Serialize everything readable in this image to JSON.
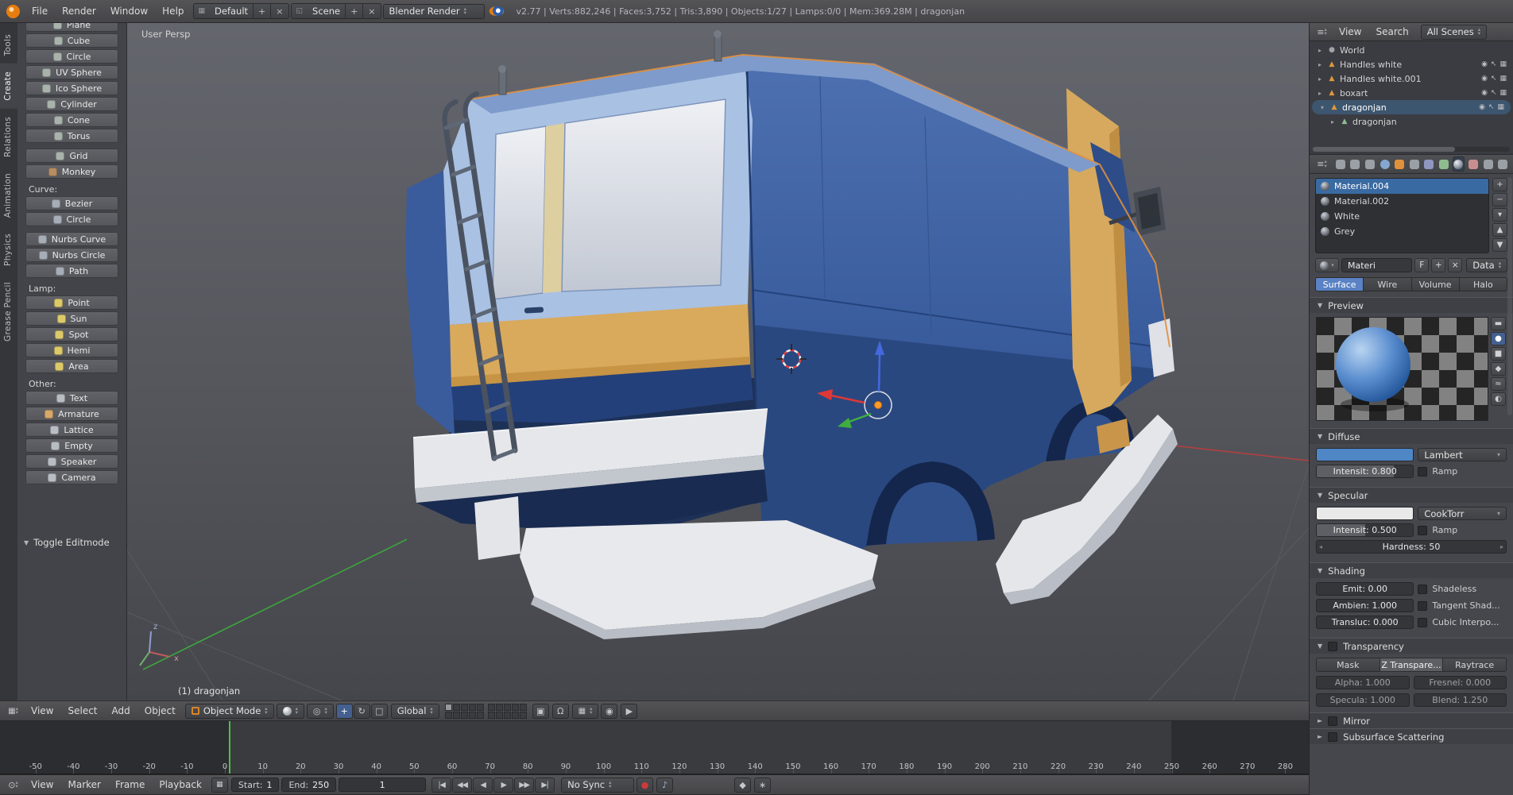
{
  "topbar": {
    "menus": [
      "File",
      "Render",
      "Window",
      "Help"
    ],
    "layout_selector": {
      "value": "Default",
      "add": "+",
      "close": "×"
    },
    "scene_selector": {
      "value": "Scene",
      "add": "+",
      "close": "×"
    },
    "engine_selector": {
      "value": "Blender Render"
    },
    "stats": "v2.77 | Verts:882,246 | Faces:3,752 | Tris:3,890 | Objects:1/27 | Lamps:0/0 | Mem:369.28M | dragonjan"
  },
  "toolshelf": {
    "tabs": [
      {
        "label": "Tools",
        "active": false
      },
      {
        "label": "Create",
        "active": true
      },
      {
        "label": "Relations",
        "active": false
      },
      {
        "label": "Animation",
        "active": false
      },
      {
        "label": "Physics",
        "active": false
      },
      {
        "label": "Grease Pencil",
        "active": false
      }
    ],
    "groups": [
      {
        "heading": "",
        "buttons": [
          {
            "label": "Plane",
            "icon": "mesh-plane-icon",
            "icon_color": "#a9b3ab"
          },
          {
            "label": "Cube",
            "icon": "mesh-cube-icon",
            "icon_color": "#a9b3ab"
          },
          {
            "label": "Circle",
            "icon": "mesh-circle-icon",
            "icon_color": "#a9b3ab"
          },
          {
            "label": "UV Sphere",
            "icon": "mesh-uvsphere-icon",
            "icon_color": "#a9b3ab"
          },
          {
            "label": "Ico Sphere",
            "icon": "mesh-icosphere-icon",
            "icon_color": "#a9b3ab"
          },
          {
            "label": "Cylinder",
            "icon": "mesh-cylinder-icon",
            "icon_color": "#a9b3ab"
          },
          {
            "label": "Cone",
            "icon": "mesh-cone-icon",
            "icon_color": "#a9b3ab"
          },
          {
            "label": "Torus",
            "icon": "mesh-torus-icon",
            "icon_color": "#a9b3ab"
          }
        ]
      },
      {
        "heading": "",
        "buttons": [
          {
            "label": "Grid",
            "icon": "mesh-grid-icon",
            "icon_color": "#a9b3ab"
          },
          {
            "label": "Monkey",
            "icon": "mesh-monkey-icon",
            "icon_color": "#b58d62"
          }
        ]
      },
      {
        "heading": "Curve:",
        "buttons": [
          {
            "label": "Bezier",
            "icon": "curve-bezier-icon",
            "icon_color": "#a6adb6"
          },
          {
            "label": "Circle",
            "icon": "curve-circle-icon",
            "icon_color": "#a6adb6"
          }
        ]
      },
      {
        "heading": "",
        "buttons": [
          {
            "label": "Nurbs Curve",
            "icon": "nurbs-curve-icon",
            "icon_color": "#a6adb6"
          },
          {
            "label": "Nurbs Circle",
            "icon": "nurbs-circle-icon",
            "icon_color": "#a6adb6"
          },
          {
            "label": "Path",
            "icon": "curve-path-icon",
            "icon_color": "#a6adb6"
          }
        ]
      },
      {
        "heading": "Lamp:",
        "buttons": [
          {
            "label": "Point",
            "icon": "lamp-point-icon",
            "icon_color": "#dcc96a"
          },
          {
            "label": "Sun",
            "icon": "lamp-sun-icon",
            "icon_color": "#dcc96a"
          },
          {
            "label": "Spot",
            "icon": "lamp-spot-icon",
            "icon_color": "#dcc96a"
          },
          {
            "label": "Hemi",
            "icon": "lamp-hemi-icon",
            "icon_color": "#dcc96a"
          },
          {
            "label": "Area",
            "icon": "lamp-area-icon",
            "icon_color": "#dcc96a"
          }
        ]
      },
      {
        "heading": "Other:",
        "buttons": [
          {
            "label": "Text",
            "icon": "text-icon",
            "icon_color": "#b8bdc4"
          },
          {
            "label": "Armature",
            "icon": "armature-icon",
            "icon_color": "#d8a869"
          },
          {
            "label": "Lattice",
            "icon": "lattice-icon",
            "icon_color": "#b8bdc4"
          },
          {
            "label": "Empty",
            "icon": "empty-icon",
            "icon_color": "#b8bdc4"
          },
          {
            "label": "Speaker",
            "icon": "speaker-icon",
            "icon_color": "#b8bdc4"
          },
          {
            "label": "Camera",
            "icon": "camera-icon",
            "icon_color": "#b8bdc4"
          }
        ]
      }
    ],
    "footer_panel": "Toggle Editmode"
  },
  "viewport": {
    "view_label": "User Persp",
    "object_label": "(1) dragonjan"
  },
  "view3d_header": {
    "menus": [
      "View",
      "Select",
      "Add",
      "Object"
    ],
    "mode": "Object Mode",
    "orientation": "Global",
    "manipulators": [
      {
        "name": "translate-manipulator-button",
        "glyph": "+",
        "active": true
      },
      {
        "name": "rotate-manipulator-button",
        "glyph": "↻",
        "active": false
      },
      {
        "name": "scale-manipulator-button",
        "glyph": "□",
        "active": false
      }
    ],
    "layers": {
      "total": 20,
      "active_index": 0
    }
  },
  "timeline": {
    "menus": [
      "View",
      "Marker",
      "Frame",
      "Playback"
    ],
    "start_label": "Start:",
    "start_value": "1",
    "end_label": "End:",
    "end_value": "250",
    "current_frame": "1",
    "sync_mode": "No Sync",
    "transport": [
      {
        "name": "jump-to-start-button",
        "glyph": "|◀"
      },
      {
        "name": "prev-keyframe-button",
        "glyph": "◀◀"
      },
      {
        "name": "play-reverse-button",
        "glyph": "◀"
      },
      {
        "name": "play-button",
        "glyph": "▶"
      },
      {
        "name": "next-keyframe-button",
        "glyph": "▶▶"
      },
      {
        "name": "jump-to-end-button",
        "glyph": "▶|"
      }
    ],
    "ruler_ticks": [
      -50,
      -40,
      -30,
      -20,
      -10,
      0,
      10,
      20,
      30,
      40,
      50,
      60,
      70,
      80,
      90,
      100,
      110,
      120,
      130,
      140,
      150,
      160,
      170,
      180,
      190,
      200,
      210,
      220,
      230,
      240,
      250,
      260,
      270,
      280
    ],
    "frame_range_start": 1,
    "frame_range_end": 250
  },
  "outliner": {
    "menus": [
      "View",
      "Search"
    ],
    "scope": "All Scenes",
    "rows": [
      {
        "label": "World",
        "icon": "world-icon",
        "icon_color": "#9fa4aa",
        "indent": 0,
        "expander": "collapsed",
        "selected": false,
        "toggles": false
      },
      {
        "label": "Handles white",
        "icon": "mesh-object-icon",
        "icon_color": "#e2973a",
        "indent": 0,
        "expander": "collapsed",
        "selected": false,
        "toggles": true
      },
      {
        "label": "Handles white.001",
        "icon": "mesh-object-icon",
        "icon_color": "#e2973a",
        "indent": 0,
        "expander": "collapsed",
        "selected": false,
        "toggles": true
      },
      {
        "label": "boxart",
        "icon": "mesh-object-icon",
        "icon_color": "#e2973a",
        "indent": 0,
        "expander": "collapsed",
        "selected": false,
        "toggles": true
      },
      {
        "label": "dragonjan",
        "icon": "mesh-object-icon",
        "icon_color": "#e2973a",
        "indent": 0,
        "expander": "expanded",
        "selected": true,
        "toggles": true
      },
      {
        "label": "dragonjan",
        "icon": "mesh-data-icon",
        "icon_color": "#8fbc8f",
        "indent": 1,
        "expander": "collapsed",
        "selected": false,
        "toggles": false
      }
    ]
  },
  "properties": {
    "tabs": [
      {
        "name": "render-icon",
        "color": "#9ba0a6",
        "shape": "square",
        "active": false
      },
      {
        "name": "render-layers-icon",
        "color": "#9ba0a6",
        "shape": "square",
        "active": false
      },
      {
        "name": "scene-icon",
        "color": "#9ba0a6",
        "shape": "square",
        "active": false
      },
      {
        "name": "world-icon",
        "color": "#84a7cf",
        "shape": "circle",
        "active": false
      },
      {
        "name": "object-icon",
        "color": "#e0913c",
        "shape": "square",
        "active": false
      },
      {
        "name": "constraints-icon",
        "color": "#9ba0a6",
        "shape": "square",
        "active": false
      },
      {
        "name": "modifiers-icon",
        "color": "#8f96c0",
        "shape": "square",
        "active": false
      },
      {
        "name": "object-data-icon",
        "color": "#8fbc8f",
        "shape": "square",
        "active": false
      },
      {
        "name": "material-icon",
        "color": "#c9ced6",
        "shape": "sphere",
        "active": true
      },
      {
        "name": "texture-icon",
        "color": "#c98f8f",
        "shape": "square",
        "active": false
      },
      {
        "name": "particles-icon",
        "color": "#9ba0a6",
        "shape": "square",
        "active": false
      },
      {
        "name": "physics-icon",
        "color": "#9ba0a6",
        "shape": "square",
        "active": false
      }
    ],
    "material_slots": {
      "items": [
        {
          "label": "Material.004",
          "selected": true
        },
        {
          "label": "Material.002",
          "selected": false
        },
        {
          "label": "White",
          "selected": false
        },
        {
          "label": "Grey",
          "selected": false
        }
      ],
      "side_buttons": [
        {
          "name": "add-material-slot-button",
          "glyph": "+"
        },
        {
          "name": "remove-material-slot-button",
          "glyph": "−"
        },
        {
          "name": "material-specials-button",
          "glyph": "▾"
        },
        {
          "name": "move-slot-up-button",
          "glyph": "▲"
        },
        {
          "name": "move-slot-down-button",
          "glyph": "▼"
        }
      ]
    },
    "datablock": {
      "name_value": "Materi",
      "fake_user": "F",
      "add": "+",
      "unlink": "×",
      "link_label": "Data"
    },
    "type_tabs": [
      {
        "label": "Surface",
        "active": true
      },
      {
        "label": "Wire",
        "active": false
      },
      {
        "label": "Volume",
        "active": false
      },
      {
        "label": "Halo",
        "active": false
      }
    ],
    "preview": {
      "title": "Preview",
      "buttons": [
        {
          "name": "preview-flat-button",
          "glyph": "▬",
          "active": false
        },
        {
          "name": "preview-sphere-button",
          "glyph": "●",
          "active": true
        },
        {
          "name": "preview-cube-button",
          "glyph": "■",
          "active": false
        },
        {
          "name": "preview-monkey-button",
          "glyph": "◆",
          "active": false
        },
        {
          "name": "preview-hair-button",
          "glyph": "≈",
          "active": false
        },
        {
          "name": "preview-world-button",
          "glyph": "◐",
          "active": false
        }
      ]
    },
    "diffuse": {
      "title": "Diffuse",
      "color": "#4e86c6",
      "shader": "Lambert",
      "intensity": "Intensit: 0.800",
      "intensity_fill": 0.8,
      "ramp": "Ramp"
    },
    "specular": {
      "title": "Specular",
      "color": "#e9e9e9",
      "shader": "CookTorr",
      "intensity": "Intensit: 0.500",
      "intensity_fill": 0.5,
      "ramp": "Ramp",
      "hardness": "Hardness: 50"
    },
    "shading": {
      "title": "Shading",
      "rows": [
        {
          "field": "Emit: 0.00",
          "check": "Shadeless"
        },
        {
          "field": "Ambien: 1.000",
          "check": "Tangent Shad..."
        },
        {
          "field": "Transluc: 0.000",
          "check": "Cubic Interpo..."
        }
      ]
    },
    "transparency": {
      "title": "Transparency",
      "modes": [
        {
          "label": "Mask",
          "active": false
        },
        {
          "label": "Z Transpare...",
          "active": true
        },
        {
          "label": "Raytrace",
          "active": false
        }
      ],
      "fields": [
        "Alpha: 1.000",
        "Fresnel: 0.000",
        "Specula: 1.000",
        "Blend: 1.250"
      ]
    },
    "mirror": {
      "title": "Mirror"
    },
    "sss": {
      "title": "Subsurface Scattering"
    }
  }
}
